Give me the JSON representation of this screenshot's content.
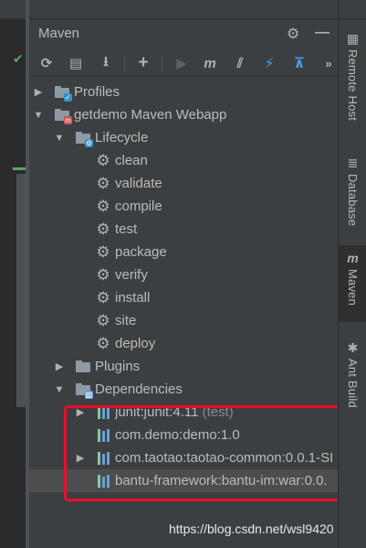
{
  "panel": {
    "title": "Maven",
    "header_icons": [
      "gear-icon",
      "minimize-icon"
    ]
  },
  "toolbar": {
    "buttons": [
      {
        "name": "reload-icon",
        "glyph": "⟳"
      },
      {
        "name": "generate-sources-icon",
        "glyph": "▤"
      },
      {
        "name": "download-icon",
        "glyph": "⭳"
      },
      {
        "name": "add-icon",
        "glyph": "+"
      },
      {
        "name": "run-icon",
        "glyph": "▶"
      },
      {
        "name": "execute-goal-icon",
        "glyph": "m"
      },
      {
        "name": "toggle-offline-icon",
        "glyph": "⧸⧸"
      },
      {
        "name": "skip-tests-icon",
        "glyph": "⚡"
      },
      {
        "name": "show-dependencies-icon",
        "glyph": "⊼"
      },
      {
        "name": "more-icon",
        "glyph": "»"
      }
    ]
  },
  "tree": {
    "profiles": "Profiles",
    "project": "getdemo Maven Webapp",
    "lifecycle": "Lifecycle",
    "goals": [
      "clean",
      "validate",
      "compile",
      "test",
      "package",
      "verify",
      "install",
      "site",
      "deploy"
    ],
    "plugins": "Plugins",
    "dependencies": "Dependencies",
    "deps": [
      {
        "label": "junit:junit:4.11",
        "scope": "(test)",
        "expandable": true
      },
      {
        "label": "com.demo:demo:1.0",
        "scope": "",
        "expandable": false
      },
      {
        "label": "com.taotao:taotao-common:0.0.1-SI",
        "scope": "",
        "expandable": true
      },
      {
        "label": "bantu-framework:bantu-im:war:0.0.",
        "scope": "",
        "expandable": false
      }
    ]
  },
  "right_tabs": [
    {
      "label": "Remote Host",
      "icon": "remote-host-icon"
    },
    {
      "label": "Database",
      "icon": "database-icon"
    },
    {
      "label": "Maven",
      "icon": "maven-icon"
    },
    {
      "label": "Ant Build",
      "icon": "ant-icon"
    }
  ],
  "watermark": "https://blog.csdn.net/wsl9420",
  "colors": {
    "background": "#3c3f41",
    "highlight_border": "#e8102a",
    "accent_blue": "#4e9bf5"
  }
}
